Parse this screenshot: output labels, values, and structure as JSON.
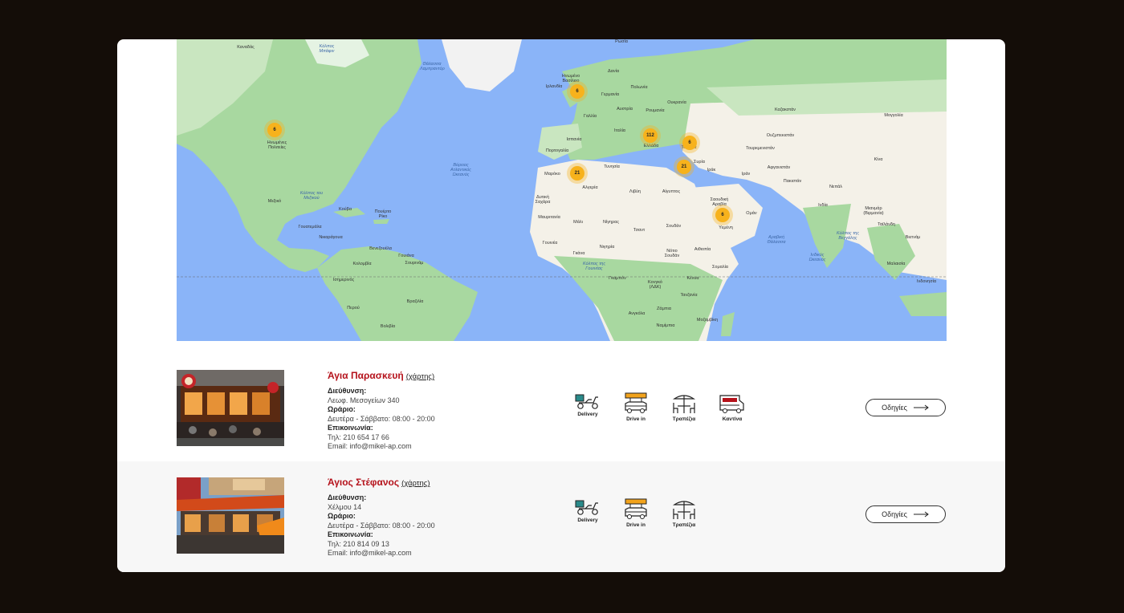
{
  "map": {
    "labels": {
      "canada": "Καναδάς",
      "usa": "Ηνωμένες Πολιτείες",
      "mexico": "Μεξικό",
      "cuba": "Κούβα",
      "puerto_rico": "Πουέρτο Ρίκο",
      "guatemala": "Γουατεμάλα",
      "nicaragua": "Νικαράγουα",
      "venezuela": "Βενεζουέλα",
      "guyana": "Γουιάνα",
      "suriname": "Σουρινάμ",
      "colombia": "Κολομβία",
      "ecuador": "Ισημερινός",
      "peru": "Περού",
      "brazil": "Βραζιλία",
      "bolivia": "Βολιβία",
      "ireland": "Ιρλανδία",
      "uk": "Ηνωμένο Βασίλειο",
      "denmark": "Δανία",
      "germany": "Γερμανία",
      "poland": "Πολωνία",
      "france": "Γαλλία",
      "spain": "Ισπανία",
      "portugal": "Πορτογαλία",
      "italy": "Ιταλία",
      "greece": "Ελλάδα",
      "austria": "Αυστρία",
      "romania": "Ρουμανία",
      "ukraine": "Ουκρανία",
      "turkey": "Τουρκία",
      "syria": "Συρία",
      "iraq": "Ιράκ",
      "iran": "Ιράν",
      "saudi": "Σαουδική Αραβία",
      "oman": "Ομάν",
      "yemen": "Υεμένη",
      "morocco": "Μαρόκο",
      "algeria": "Αλγερία",
      "libya": "Λιβύη",
      "egypt": "Αίγυπτος",
      "tunisia": "Τυνησία",
      "western_sahara": "Δυτική Σαχάρα",
      "mauritania": "Μαυριτανία",
      "mali": "Μάλι",
      "niger": "Νίγηρας",
      "chad": "Τσαντ",
      "sudan": "Σουδάν",
      "nigeria": "Νιγηρία",
      "guinea": "Γουινέα",
      "ghana": "Γκάνα",
      "ethiopia": "Αιθιοπία",
      "south_sudan": "Νότιο Σουδάν",
      "somalia": "Σομαλία",
      "kenya": "Κένυα",
      "gabon": "Γκαμπόν",
      "congo_drc": "Κονγκό (ΛΔΚ)",
      "tanzania": "Τανζανία",
      "angola": "Ανγκόλα",
      "zambia": "Ζάμπια",
      "mozambique": "Μοζαμβίκη",
      "namibia": "Ναμίμπια",
      "madagascar": "Μαδαγασκάρη",
      "kazakhstan": "Καζακστάν",
      "mongolia": "Μογγολία",
      "china": "Κίνα",
      "uzbekistan": "Ουζμπεκιστάν",
      "turkmenistan": "Τουρκμενιστάν",
      "afghanistan": "Αφγανιστάν",
      "pakistan": "Πακιστάν",
      "nepal": "Νεπάλ",
      "india": "Ινδία",
      "myanmar": "Μιανμάρ (Βιρμανία)",
      "thailand": "Ταϊλάνδη",
      "vietnam": "Βιετνάμ",
      "malaysia": "Μαλαισία",
      "indonesia": "Ινδονησία",
      "russia": "Ρωσία",
      "north_atlantic": "Βόρειος Ατλαντικός Ωκεανός",
      "gulf_mexico": "Κόλπος του Μεξικού",
      "arabian_sea": "Αραβική Θάλασσα",
      "bay_bengal": "Κόλπος της Βεγγάλης",
      "indian_ocean": "Ινδικός Ωκεανός",
      "gulf_guinea": "Κόλπος της Γουινέας",
      "labrador_sea": "Θάλασσα Λαμπραντόρ",
      "baffin_bay": "Κόλπος Μπάφιν"
    },
    "clusters": [
      {
        "id": "usa",
        "count": "6"
      },
      {
        "id": "uk",
        "count": "6"
      },
      {
        "id": "greece",
        "count": "112"
      },
      {
        "id": "turkey",
        "count": "6"
      },
      {
        "id": "cyprus",
        "count": "21"
      },
      {
        "id": "morocco",
        "count": "21"
      },
      {
        "id": "saudi",
        "count": "6"
      }
    ]
  },
  "stores": [
    {
      "name": "Άγια Παρασκευή",
      "map_link": "(χάρτης)",
      "address_label": "Διεύθυνση:",
      "address": "Λεωφ. Μεσογείων 340",
      "hours_label": "Ωράριο:",
      "hours": "Δευτέρα - Σάββατο: 08:00 - 20:00",
      "contact_label": "Επικοινωνία:",
      "phone": "Τηλ: 210 654 17 66",
      "email": "Email: info@mikel-ap.com",
      "services": [
        "Delivery",
        "Drive in",
        "Τραπέζια",
        "Καντίνα"
      ],
      "directions_label": "Οδηγίες"
    },
    {
      "name": "Άγιος Στέφανος",
      "map_link": "(χάρτης)",
      "address_label": "Διεύθυνση:",
      "address": "Χέλμου 14",
      "hours_label": "Ωράριο:",
      "hours": "Δευτέρα - Σάββατο: 08:00 - 20:00",
      "contact_label": "Επικοινωνία:",
      "phone": "Τηλ: 210 814 09 13",
      "email": "Email: info@mikel-ap.com",
      "services": [
        "Delivery",
        "Drive in",
        "Τραπέζια"
      ],
      "directions_label": "Οδηγίες"
    }
  ],
  "colors": {
    "brand": "#b5121b",
    "cluster": "#f7b21c",
    "water": "#8ab4f8",
    "land": "#a8d8a0"
  }
}
